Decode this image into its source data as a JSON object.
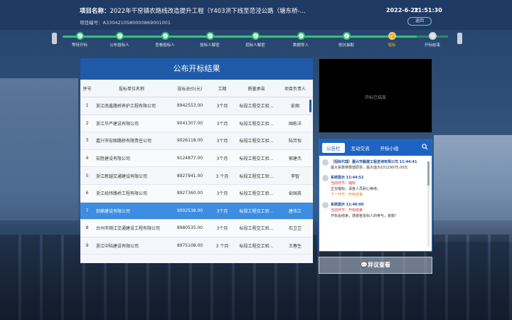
{
  "header": {
    "project_label": "项目名称：",
    "project_name": "2022年干窑镇农路线改造提升工程（Y403洪下线至范泾公路（塘东桥-...",
    "project_no_label": "项目编号：",
    "project_no": "A3304210580000869001001",
    "date": "2022-6-22",
    "time": "11:51:30",
    "back_label": "返回"
  },
  "steps": [
    {
      "label": "等待开标",
      "state": "done"
    },
    {
      "label": "公布投标人",
      "state": "done"
    },
    {
      "label": "查看投标人",
      "state": "done"
    },
    {
      "label": "投标人解密",
      "state": "done"
    },
    {
      "label": "招标人解密",
      "state": "done"
    },
    {
      "label": "数据导入",
      "state": "done"
    },
    {
      "label": "抵抗抽取",
      "state": "done"
    },
    {
      "label": "唱标",
      "state": "active"
    },
    {
      "label": "开标结束",
      "state": "todo"
    }
  ],
  "results": {
    "title": "公布开标结果",
    "columns": [
      "序号",
      "投标单位名称",
      "投标总价(元)",
      "工期",
      "质量承诺",
      "项目负责人"
    ],
    "rows": [
      {
        "no": "1",
        "name": "浙江南鑫路桥养护工程有限公司",
        "price": "8942553.00",
        "period": "3个月",
        "quality": "标段工程交工验...",
        "leader": "俞翔"
      },
      {
        "no": "2",
        "name": "浙江华严建设有限公司",
        "price": "9041307.00",
        "period": "3个月",
        "quality": "标段工程交工验...",
        "leader": "国栋洋"
      },
      {
        "no": "3",
        "name": "嘉兴市宏图路桥有限责任公司",
        "price": "9026118.00",
        "period": "3个月",
        "quality": "标段工程交工验...",
        "leader": "陆芳怡"
      },
      {
        "no": "4",
        "name": "宏胜建设有限公司",
        "price": "9124877.00",
        "period": "3个月",
        "quality": "标段工程交工验...",
        "leader": "郭建杰"
      },
      {
        "no": "5",
        "name": "浙江新越交通建设有限公司",
        "price": "8927941.00",
        "period": "3 个月",
        "quality": "标段工程交工验...",
        "leader": "李智"
      },
      {
        "no": "6",
        "name": "浙江经纬路桥工程有限公司",
        "price": "8927360.00",
        "period": "3个月",
        "quality": "标段工程交工验...",
        "leader": "俞国英"
      },
      {
        "no": "7",
        "name": "劲鼎建设有限公司",
        "price": "9002538.00",
        "period": "3个月",
        "quality": "标段工程交工验...",
        "leader": "唐伟江"
      },
      {
        "no": "8",
        "name": "台州市顺江交通建设工程有限公司",
        "price": "8980535.00",
        "period": "3个月",
        "quality": "标段工程交工验...",
        "leader": "石卫卫"
      },
      {
        "no": "9",
        "name": "浙江中陆建设有限公司",
        "price": "8975108.00",
        "period": "3 个月",
        "quality": "标段工程交工验...",
        "leader": "王春生"
      }
    ],
    "selected_index": 6
  },
  "video": {
    "status": "开标已结束"
  },
  "messages": {
    "tabs": [
      "公告栏",
      "互动交流",
      "开标小组"
    ],
    "active_tab": 0,
    "items": [
      {
        "sender": "（招标代理）嘉兴市融建工程咨询有限公司",
        "time": "11:44:41",
        "lines": [
          "最大系数参数值原票，最大值为10129075.00元"
        ]
      },
      {
        "sender": "系统提示",
        "time": "11:44:52",
        "tag": "当前环节：唱标",
        "lines": [
          "正在唱标，请各人员耐心等待。"
        ],
        "next": "下一环节：开标结束"
      },
      {
        "sender": "系统提示",
        "time": "11:46:00",
        "tag": "当前环节：开标结束",
        "lines": [
          "开标会结束，感谢各投标人的参与，谢谢！"
        ]
      }
    ]
  },
  "objection_label": "异议查看",
  "colors": {
    "accent": "#1f5aa8",
    "done": "#37c07a",
    "active": "#f0a930",
    "selected_row": "#3d8de0"
  }
}
